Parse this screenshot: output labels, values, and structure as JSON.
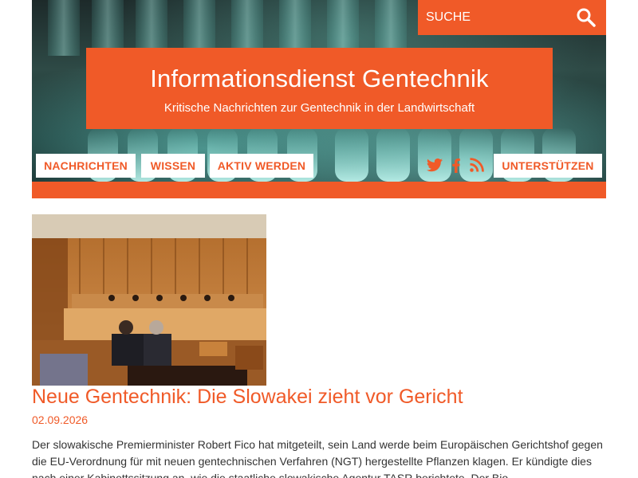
{
  "search": {
    "placeholder": "SUCHE"
  },
  "header": {
    "title": "Informationsdienst Gentechnik",
    "subtitle": "Kritische Nachrichten zur Gentechnik in der Landwirtschaft"
  },
  "nav": {
    "items": [
      {
        "label": "NACHRICHTEN"
      },
      {
        "label": "WISSEN"
      },
      {
        "label": "AKTIV WERDEN"
      }
    ],
    "support_label": "UNTERSTÜTZEN",
    "social_icons": [
      "twitter-icon",
      "facebook-icon",
      "rss-icon"
    ]
  },
  "article": {
    "title": "Neue Gentechnik: Die Slowakei zieht vor Gericht",
    "date": "02.09.2026",
    "text": "Der slowakische Premierminister Robert Fico hat mitgeteilt, sein Land werde beim Europäischen Gerichtshof gegen die EU-Verordnung für mit neuen gentechnischen Verfahren (NGT) hergestellte Pflanzen klagen. Er kündigte dies nach einer Kabinettssitzung an, wie die staatliche slowakische Agentur TASR berichtete. Der Bio-"
  },
  "colors": {
    "accent": "#f05a28",
    "text": "#333333",
    "white": "#ffffff"
  }
}
